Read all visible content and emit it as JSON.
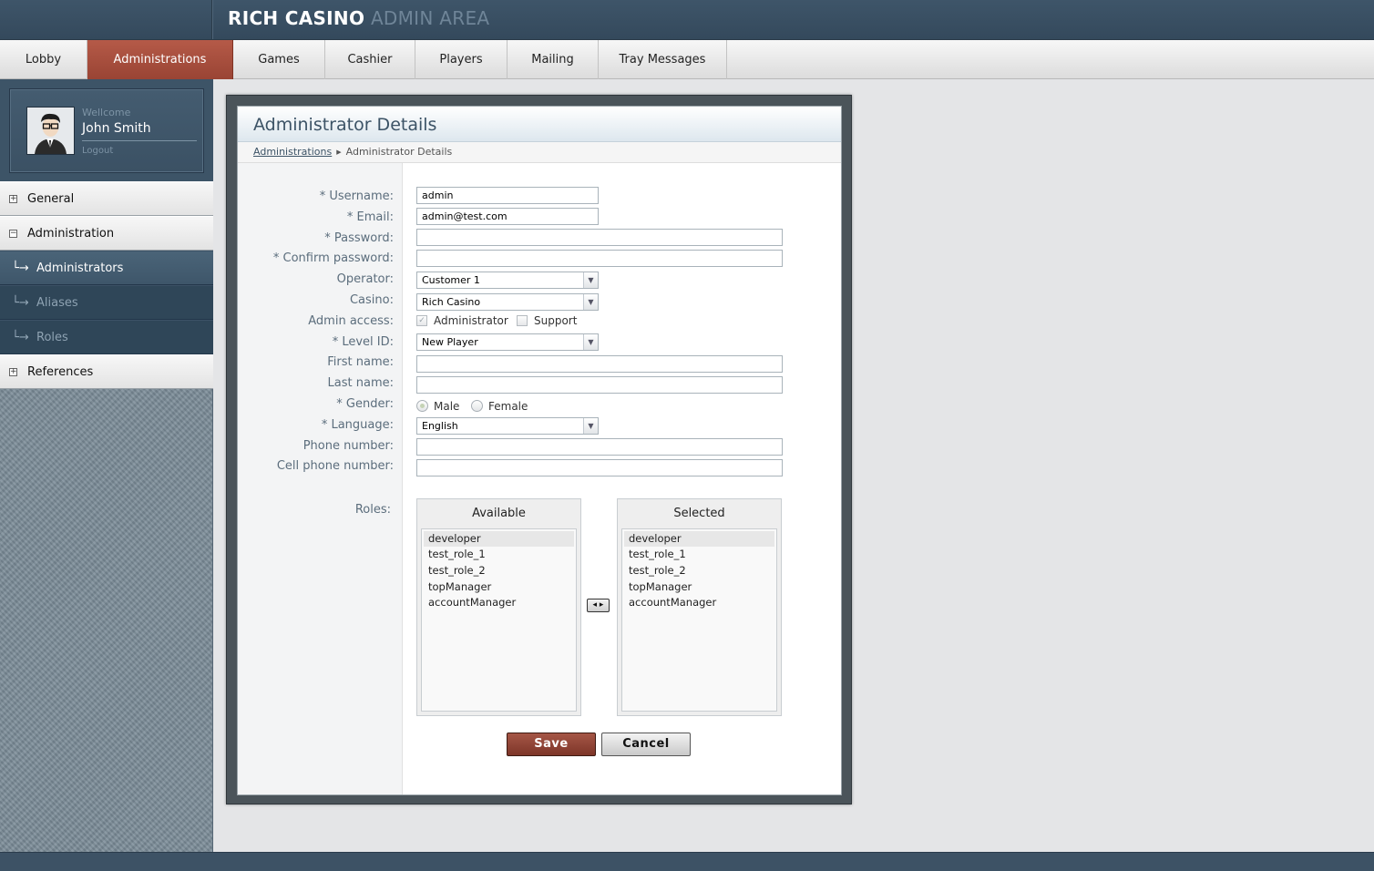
{
  "header": {
    "brand_main": "RICH CASINO",
    "brand_sub": "ADMIN AREA"
  },
  "nav": {
    "active": "Administrations",
    "tabs": [
      "Lobby",
      "Administrations",
      "Games",
      "Cashier",
      "Players",
      "Mailing",
      "Tray Messages"
    ]
  },
  "user": {
    "welcome": "Wellcome",
    "name": "John Smith",
    "logout": "Logout",
    "avatar_icon": "user-avatar-icon"
  },
  "sidebar": {
    "items": [
      {
        "label": "General",
        "kind": "group",
        "state": "collapsed"
      },
      {
        "label": "Administration",
        "kind": "group",
        "state": "expanded"
      },
      {
        "label": "Administrators",
        "kind": "sub",
        "active": true
      },
      {
        "label": "Aliases",
        "kind": "sub",
        "active": false
      },
      {
        "label": "Roles",
        "kind": "sub",
        "active": false
      },
      {
        "label": "References",
        "kind": "group",
        "state": "collapsed"
      }
    ]
  },
  "panel": {
    "title": "Administrator Details",
    "breadcrumb": [
      "Administrations",
      "Administrator Details"
    ]
  },
  "form": {
    "username": {
      "label": "* Username:",
      "value": "admin"
    },
    "email": {
      "label": "* Email:",
      "value": "admin@test.com"
    },
    "password": {
      "label": "* Password:",
      "value": ""
    },
    "confirm_password": {
      "label": "* Confirm password:",
      "value": ""
    },
    "operator": {
      "label": "Operator:",
      "value": "Customer 1"
    },
    "casino": {
      "label": "Casino:",
      "value": "Rich Casino"
    },
    "admin_access": {
      "label": "Admin access:",
      "options": [
        {
          "label": "Administrator",
          "checked": true,
          "disabled": true
        },
        {
          "label": "Support",
          "checked": false,
          "disabled": false
        }
      ]
    },
    "level_id": {
      "label": "* Level ID:",
      "value": "New Player"
    },
    "first_name": {
      "label": "First name:",
      "value": ""
    },
    "last_name": {
      "label": "Last name:",
      "value": ""
    },
    "gender": {
      "label": "* Gender:",
      "options": [
        {
          "label": "Male",
          "selected": true
        },
        {
          "label": "Female",
          "selected": false
        }
      ]
    },
    "language": {
      "label": "* Language:",
      "value": "English"
    },
    "phone": {
      "label": "Phone number:",
      "value": ""
    },
    "cell_phone": {
      "label": "Cell phone number:",
      "value": ""
    },
    "roles": {
      "label": "Roles:",
      "available_title": "Available",
      "selected_title": "Selected",
      "available": [
        "developer",
        "test_role_1",
        "test_role_2",
        "topManager",
        "accountManager"
      ],
      "selected": [
        "developer",
        "test_role_1",
        "test_role_2",
        "topManager",
        "accountManager"
      ],
      "highlighted": "developer",
      "move_icon": "left-right-arrows-icon"
    }
  },
  "buttons": {
    "save": "Save",
    "cancel": "Cancel"
  },
  "colors": {
    "header_bg": "#3a5063",
    "nav_active": "#a64e3d",
    "sidebar_active": "#4a6478",
    "save_button": "#8f4334",
    "panel_frame": "#4b545a",
    "title_text": "#3c5366"
  }
}
